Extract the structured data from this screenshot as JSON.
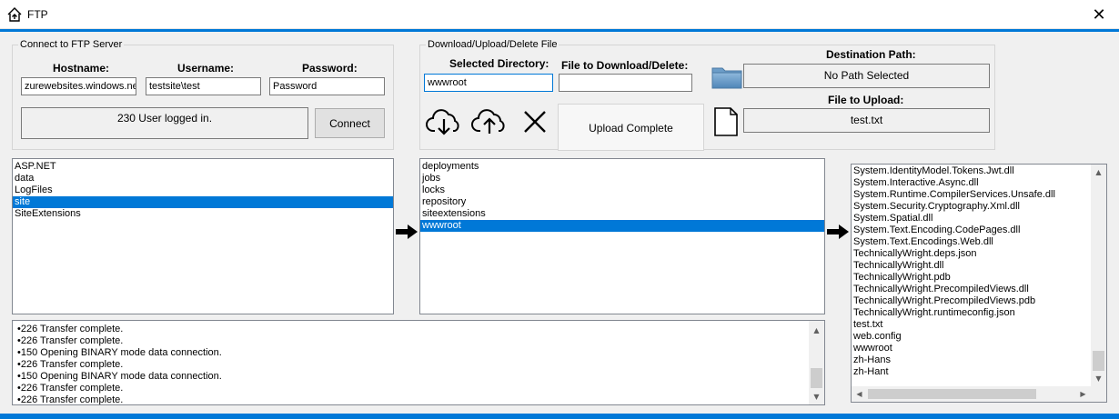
{
  "window": {
    "title": "FTP",
    "close_glyph": "✕",
    "icon": "home-upload-icon"
  },
  "connect": {
    "legend": "Connect to FTP Server",
    "hostname_label": "Hostname:",
    "hostname_value": "zurewebsites.windows.net",
    "username_label": "Username:",
    "username_value": "testsite\\test",
    "password_label": "Password:",
    "password_value": "Password",
    "status": "230 User logged in.",
    "connect_button": "Connect"
  },
  "transfer": {
    "legend": "Download/Upload/Delete File",
    "selected_dir_label": "Selected Directory:",
    "selected_dir_value": "wwwroot",
    "file_label": "File to Download/Delete:",
    "file_value": "",
    "status": "Upload Complete",
    "icons": [
      "cloud-download-icon",
      "cloud-upload-icon",
      "delete-x-icon"
    ]
  },
  "destination": {
    "path_label": "Destination Path:",
    "path_value": "No Path Selected",
    "upload_label": "File to Upload:",
    "upload_value": "test.txt",
    "icons": [
      "folder-icon",
      "file-icon"
    ]
  },
  "lists": {
    "root": [
      "ASP.NET",
      "data",
      "LogFiles",
      "site",
      "SiteExtensions"
    ],
    "root_selected": "site",
    "site": [
      "deployments",
      "jobs",
      "locks",
      "repository",
      "siteextensions",
      "wwwroot"
    ],
    "site_selected": "wwwroot",
    "wwwroot": [
      "System.IdentityModel.Tokens.Jwt.dll",
      "System.Interactive.Async.dll",
      "System.Runtime.CompilerServices.Unsafe.dll",
      "System.Security.Cryptography.Xml.dll",
      "System.Spatial.dll",
      "System.Text.Encoding.CodePages.dll",
      "System.Text.Encodings.Web.dll",
      "TechnicallyWright.deps.json",
      "TechnicallyWright.dll",
      "TechnicallyWright.pdb",
      "TechnicallyWright.PrecompiledViews.dll",
      "TechnicallyWright.PrecompiledViews.pdb",
      "TechnicallyWright.runtimeconfig.json",
      "test.txt",
      "web.config",
      "wwwroot",
      "zh-Hans",
      "zh-Hant"
    ]
  },
  "log": [
    "•226 Transfer complete.",
    "•226 Transfer complete.",
    "•150 Opening BINARY mode data connection.",
    "•226 Transfer complete.",
    "•150 Opening BINARY mode data connection.",
    "•226 Transfer complete.",
    "•226 Transfer complete."
  ],
  "colors": {
    "accent": "#0078d7",
    "selection": "#0078d7",
    "panel": "#f0f0f0"
  }
}
